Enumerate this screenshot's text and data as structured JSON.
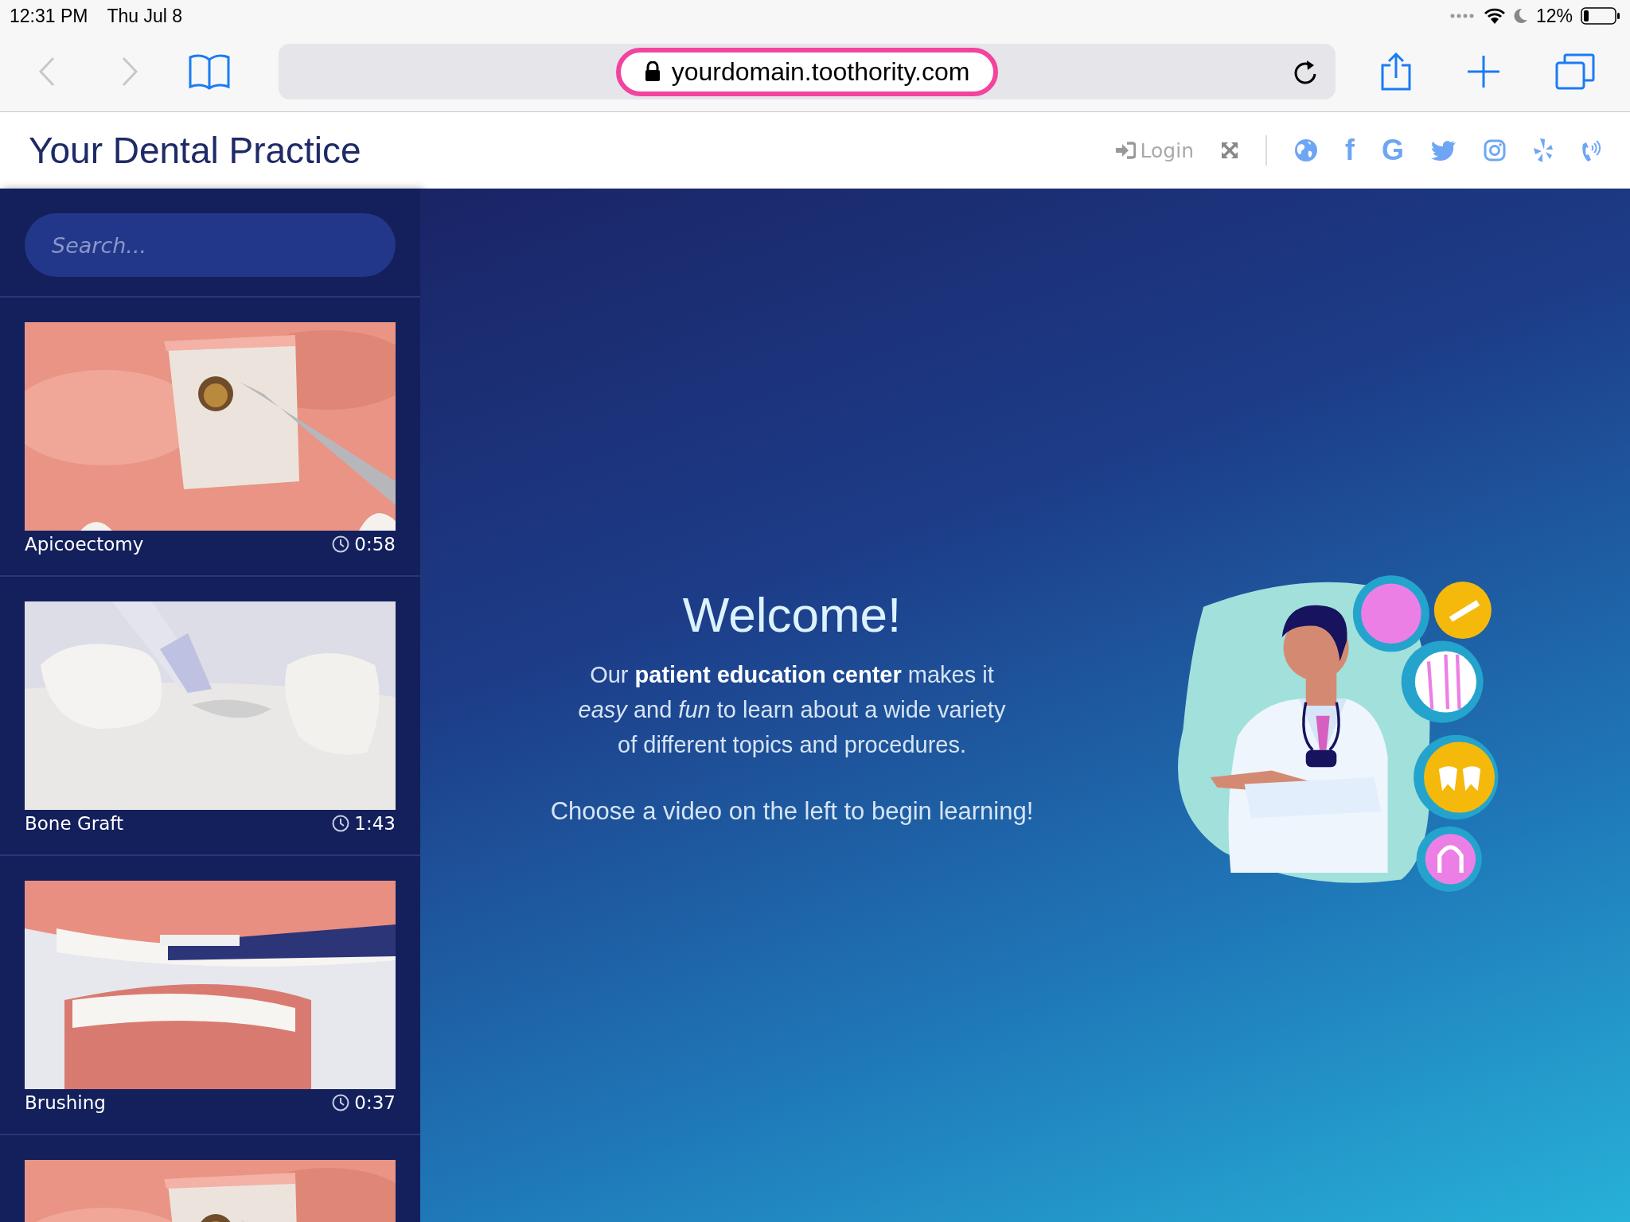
{
  "status_bar": {
    "time": "12:31 PM",
    "date": "Thu Jul 8",
    "battery": "12%"
  },
  "browser": {
    "back": {
      "disabled": true
    },
    "forward": {
      "disabled": true
    },
    "url": "yourdomain.toothority.com",
    "url_highlighted": true
  },
  "header": {
    "title": "Your Dental Practice",
    "login": "Login",
    "social": [
      {
        "kind": "globe"
      },
      {
        "kind": "facebook",
        "glyph": "f"
      },
      {
        "kind": "google",
        "glyph": "G"
      },
      {
        "kind": "twitter"
      },
      {
        "kind": "instagram"
      },
      {
        "kind": "yelp"
      },
      {
        "kind": "phone"
      }
    ]
  },
  "sidebar": {
    "search": {
      "placeholder": "Search..."
    },
    "videos": [
      {
        "kind": "gum",
        "title": "Apicoectomy",
        "duration": "0:58"
      },
      {
        "kind": "bone",
        "title": "Bone Graft",
        "duration": "1:43"
      },
      {
        "kind": "brushing",
        "title": "Brushing",
        "duration": "0:37"
      },
      {
        "kind": "gum"
      }
    ]
  },
  "welcome": {
    "title": "Welcome!",
    "text": "Our **patient education center** makes it *easy* and *fun* to learn about a wide variety of different topics and procedures.",
    "prompt": "Choose a video on the left to begin learning!"
  }
}
